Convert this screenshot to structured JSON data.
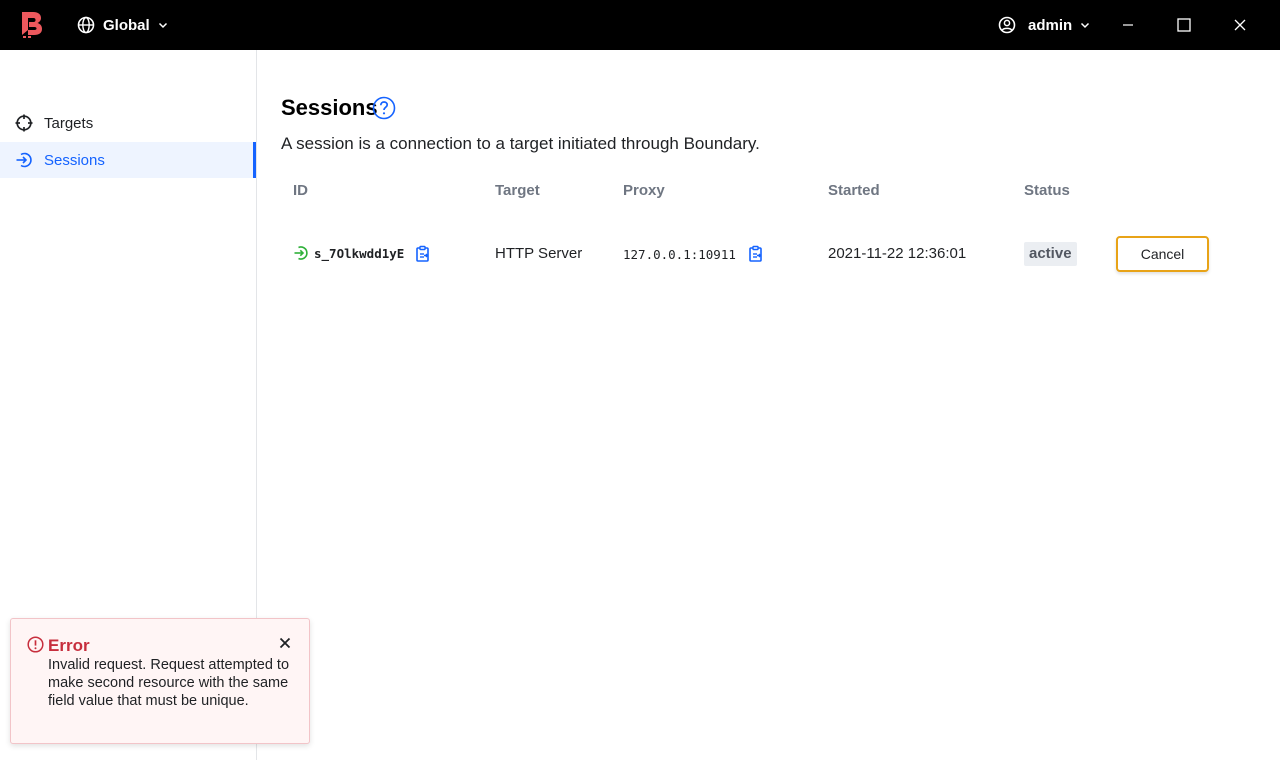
{
  "header": {
    "scope_label": "Global",
    "user_label": "admin",
    "brand_color": "#ec585d"
  },
  "sidebar": {
    "items": [
      {
        "label": "Targets",
        "icon": "target-icon",
        "active": false
      },
      {
        "label": "Sessions",
        "icon": "sessions-icon",
        "active": true
      }
    ]
  },
  "main": {
    "title": "Sessions",
    "description": "A session is a connection to a target initiated through Boundary.",
    "table": {
      "columns": [
        "ID",
        "Target",
        "Proxy",
        "Started",
        "Status"
      ],
      "rows": [
        {
          "id": "s_7Olkwdd1yE",
          "target": "HTTP Server",
          "proxy": "127.0.0.1:10911",
          "started": "2021-11-22 12:36:01",
          "status": "active",
          "action_label": "Cancel"
        }
      ]
    }
  },
  "toast": {
    "title": "Error",
    "message": "Invalid request. Request attempted to make second resource with the same field value that must be unique.",
    "color": "#c72e3d"
  }
}
